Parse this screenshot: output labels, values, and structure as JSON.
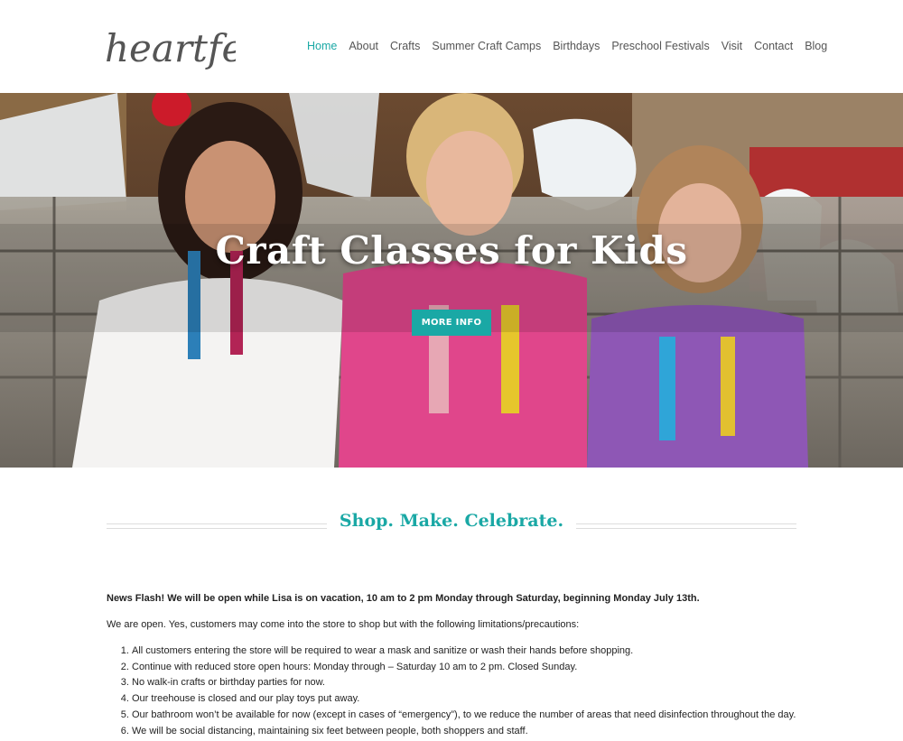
{
  "brand": {
    "logo_text": "heartfelt"
  },
  "nav": {
    "items": [
      {
        "label": "Home",
        "active": true
      },
      {
        "label": "About"
      },
      {
        "label": "Crafts"
      },
      {
        "label": "Summer Craft Camps"
      },
      {
        "label": "Birthdays"
      },
      {
        "label": "Preschool Festivals"
      },
      {
        "label": "Visit"
      },
      {
        "label": "Contact"
      },
      {
        "label": "Blog"
      }
    ]
  },
  "hero": {
    "title": "Craft Classes for Kids",
    "button_label": "MORE INFO"
  },
  "tagline": "Shop. Make. Celebrate.",
  "content": {
    "news_flash": "News Flash! We will be open while Lisa is on vacation, 10 am to 2 pm Monday through Saturday, beginning Monday July 13th.",
    "intro": "We are open. Yes, customers may come into the store to shop but with the following limitations/precautions:",
    "list": [
      "All customers entering the store will be required to wear a mask and sanitize or wash their hands before shopping.",
      "Continue with reduced store open hours: Monday through – Saturday 10 am to 2 pm. Closed Sunday.",
      "No walk-in crafts or birthday parties for now.",
      "Our treehouse is closed and our play toys put away.",
      "Our bathroom won’t be available for now (except in cases of “emergency”), to we reduce the number of areas that need disinfection throughout the day.",
      "We will be social distancing, maintaining six feet between people, both shoppers and staff."
    ]
  },
  "colors": {
    "accent": "#1aa8a5"
  }
}
